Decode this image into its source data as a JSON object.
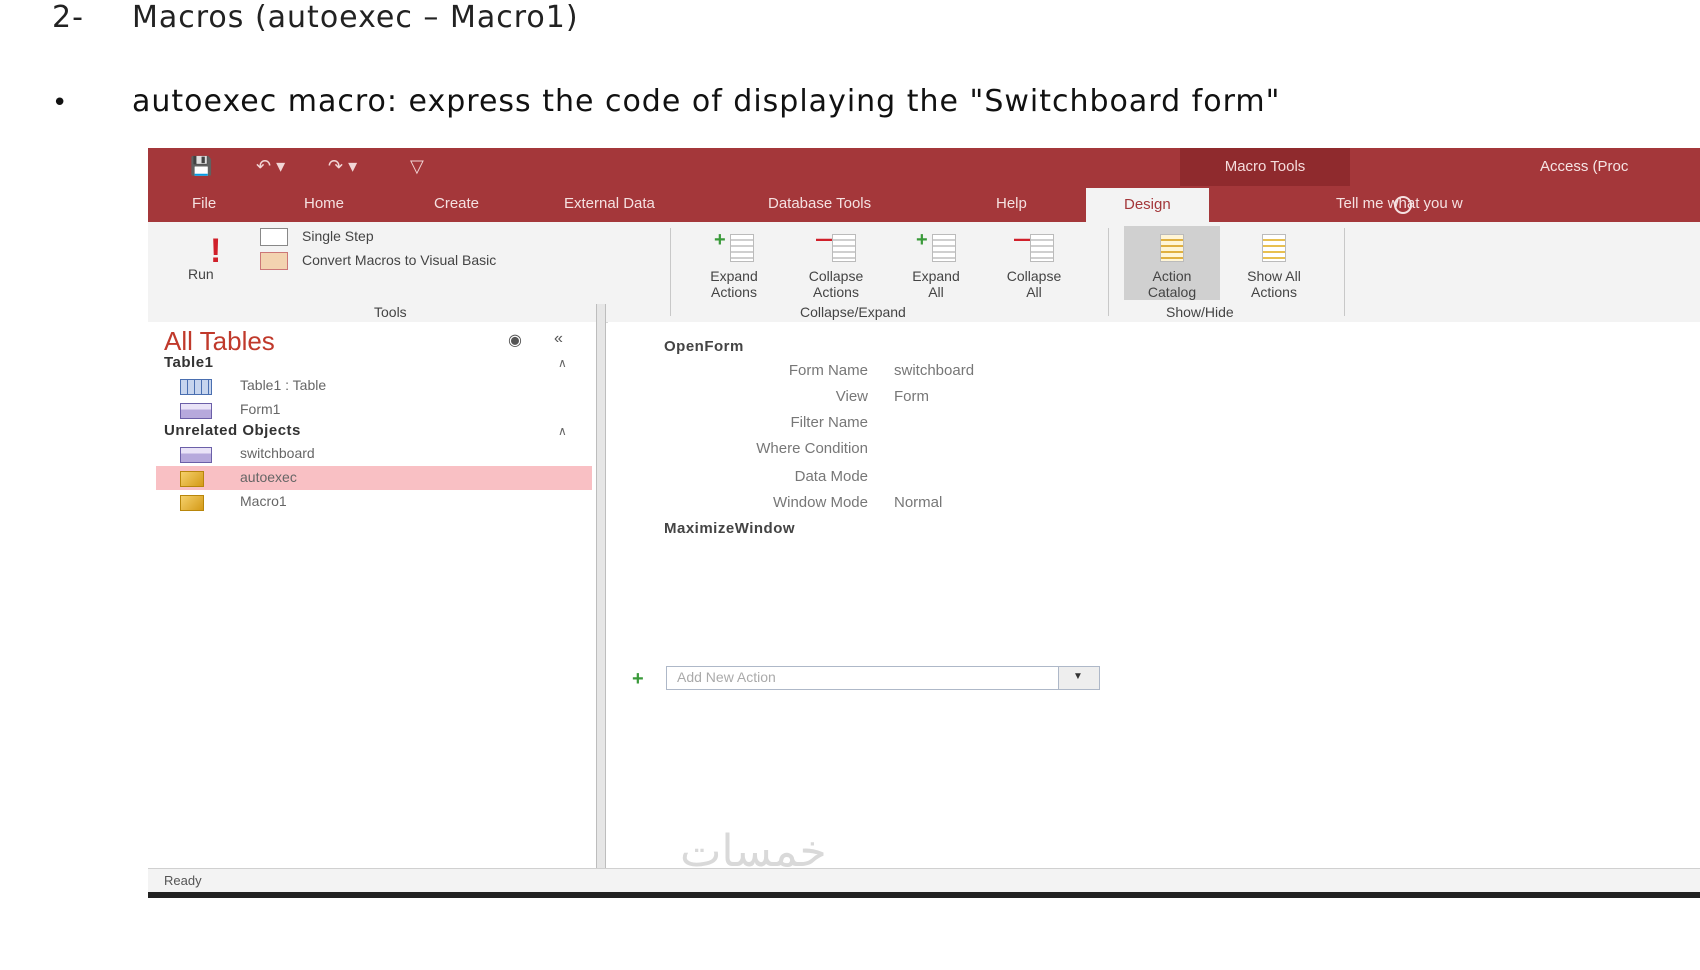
{
  "document": {
    "heading_num": "2-",
    "heading_text": "Macros (autoexec – Macro1)",
    "bullet_symbol": "•",
    "bullet_text": "autoexec macro: express the code of displaying the \"Switchboard form\""
  },
  "window": {
    "contextual_tab_group": "Macro Tools",
    "app_title": "Access (Proc",
    "tell_me": "Tell me what you w"
  },
  "tabs": [
    "File",
    "Home",
    "Create",
    "External Data",
    "Database Tools",
    "Help",
    "Design"
  ],
  "ribbon": {
    "run_label": "Run",
    "single_step_label": "Single Step",
    "convert_label": "Convert Macros to Visual Basic",
    "tools_group": "Tools",
    "expand_actions": [
      "Expand",
      "Actions"
    ],
    "collapse_actions": [
      "Collapse",
      "Actions"
    ],
    "expand_all": [
      "Expand",
      "All"
    ],
    "collapse_all": [
      "Collapse",
      "All"
    ],
    "collapse_expand_group": "Collapse/Expand",
    "action_catalog": [
      "Action",
      "Catalog"
    ],
    "show_all_actions": [
      "Show All",
      "Actions"
    ],
    "show_hide_group": "Show/Hide"
  },
  "nav": {
    "title": "All Tables",
    "groups": [
      {
        "name": "Table1",
        "items": [
          {
            "label": "Table1 : Table",
            "icon": "table-icon"
          },
          {
            "label": "Form1",
            "icon": "form-icon"
          }
        ]
      },
      {
        "name": "Unrelated Objects",
        "items": [
          {
            "label": "switchboard",
            "icon": "form-icon"
          },
          {
            "label": "autoexec",
            "icon": "macro-icon",
            "selected": true
          },
          {
            "label": "Macro1",
            "icon": "macro-icon"
          }
        ]
      }
    ]
  },
  "macro": {
    "action1": "OpenForm",
    "args": [
      {
        "label": "Form Name",
        "value": "switchboard"
      },
      {
        "label": "View",
        "value": "Form"
      },
      {
        "label": "Filter Name",
        "value": ""
      },
      {
        "label": "Where Condition",
        "value": ""
      },
      {
        "label": "Data Mode",
        "value": ""
      },
      {
        "label": "Window Mode",
        "value": "Normal"
      }
    ],
    "action2": "MaximizeWindow",
    "add_new_placeholder": "Add New Action"
  },
  "status": "Ready",
  "watermark": "خمسات",
  "colors": {
    "accent": "#a4373a",
    "selection": "#f9c0c4"
  }
}
